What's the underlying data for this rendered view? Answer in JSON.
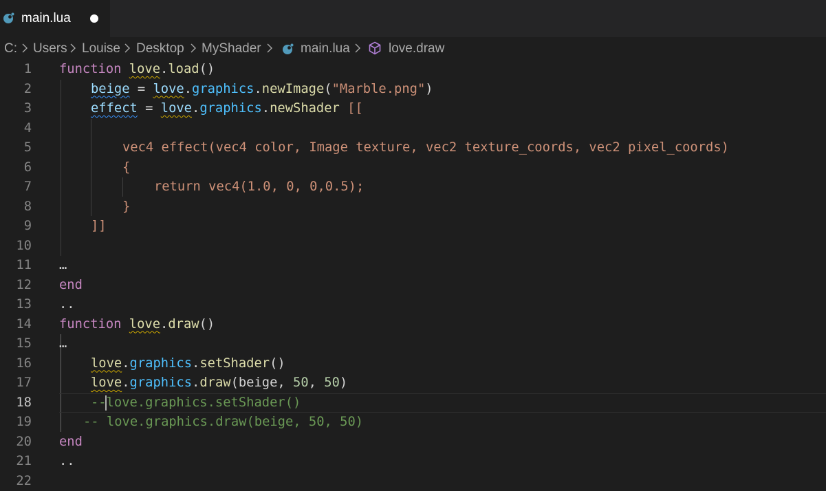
{
  "tab": {
    "file_name": "main.lua",
    "icon": "lua-moon-icon",
    "unsaved": true
  },
  "breadcrumb": {
    "items": [
      "C:",
      "Users",
      "Louise",
      "Desktop",
      "MyShader",
      "main.lua",
      "love.draw"
    ]
  },
  "editor": {
    "active_line": 18,
    "line_numbers": [
      "1",
      "2",
      "3",
      "4",
      "5",
      "6",
      "7",
      "8",
      "9",
      "10",
      "11",
      "12",
      "13",
      "14",
      "15",
      "16",
      "17",
      "18",
      "19",
      "20",
      "21",
      "22"
    ],
    "lines": {
      "l1": {
        "kw": "function",
        "obj": "love",
        "dot": ".",
        "fn": "load",
        "rest": "()"
      },
      "l2": {
        "var": "beige",
        "eq": " = ",
        "obj": "love",
        "dot1": ".",
        "mod": "graphics",
        "dot2": ".",
        "fn": "newImage",
        "open": "(",
        "str": "\"Marble.png\"",
        "close": ")"
      },
      "l3": {
        "var": "effect",
        "eq": " = ",
        "obj": "love",
        "dot1": ".",
        "mod": "graphics",
        "dot2": ".",
        "fn": "newShader",
        "open": " [["
      },
      "l5": {
        "text": "vec4 effect(vec4 color, Image texture, vec2 texture_coords, vec2 pixel_coords)"
      },
      "l6": {
        "text": "{"
      },
      "l7": {
        "text": "return vec4(1.0, 0, 0,0.5);"
      },
      "l8": {
        "text": "}"
      },
      "l9": {
        "text": "]]"
      },
      "l11": {
        "text": "…"
      },
      "l12": {
        "kw": "end"
      },
      "l13": {
        "text": ".."
      },
      "l14": {
        "kw": "function",
        "obj": "love",
        "dot": ".",
        "fn": "draw",
        "rest": "()"
      },
      "l15": {
        "text": "…"
      },
      "l16": {
        "obj": "love",
        "dot1": ".",
        "mod": "graphics",
        "dot2": ".",
        "fn": "setShader",
        "rest": "()"
      },
      "l17": {
        "obj": "love",
        "dot1": ".",
        "mod": "graphics",
        "dot2": ".",
        "fn": "draw",
        "open": "(",
        "arg": "beige",
        "c1": ", ",
        "n1": "50",
        "c2": ", ",
        "n2": "50",
        "close": ")"
      },
      "l18": {
        "dash": "--",
        "rest": "love.graphics.setShader()"
      },
      "l19": {
        "text": "-- love.graphics.draw(beige, 50, 50)"
      },
      "l20": {
        "kw": "end"
      },
      "l21": {
        "text": ".."
      }
    }
  },
  "colors": {
    "background": "#1e1e1e",
    "keyword": "#c586c0",
    "function": "#dcdcaa",
    "variable": "#9cdcfe",
    "string": "#ce9178",
    "number": "#b5cea8",
    "comment": "#6a9955"
  }
}
